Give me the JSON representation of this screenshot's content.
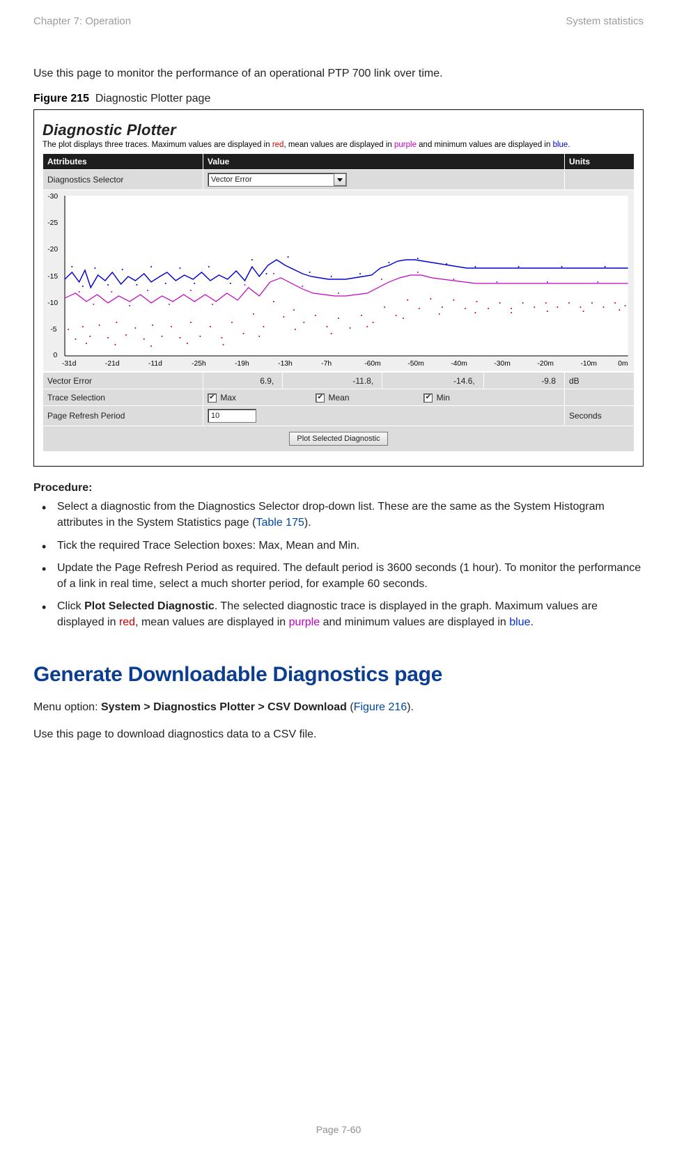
{
  "header": {
    "left": "Chapter 7:  Operation",
    "right": "System statistics"
  },
  "intro": "Use this page to monitor the performance of an operational PTP 700 link over time.",
  "figure": {
    "label": "Figure 215",
    "caption": "Diagnostic Plotter page"
  },
  "plotter": {
    "title": "Diagnostic Plotter",
    "sub_pre": "The plot displays three traces. Maximum values are displayed in ",
    "sub_red": "red",
    "sub_mid1": ", mean values are displayed in ",
    "sub_purple": "purple",
    "sub_mid2": " and minimum values are displayed in ",
    "sub_blue": "blue",
    "sub_end": ".",
    "th_attr": "Attributes",
    "th_value": "Value",
    "th_units": "Units",
    "row_selector_label": "Diagnostics Selector",
    "selector_value": "Vector Error",
    "row_vector_label": "Vector Error",
    "vector_vals": [
      "6.9,",
      "-11.8,",
      "-14.6,",
      "-9.8"
    ],
    "vector_units": "dB",
    "row_trace_label": "Trace Selection",
    "trace_opts": [
      "Max",
      "Mean",
      "Min"
    ],
    "row_refresh_label": "Page Refresh Period",
    "refresh_value": "10",
    "refresh_units": "Seconds",
    "button": "Plot Selected Diagnostic"
  },
  "chart_data": {
    "type": "line",
    "ylabel": "",
    "xlabel": "",
    "ylim": [
      0,
      -30
    ],
    "y_ticks": [
      "-30",
      "-25",
      "-20",
      "-15",
      "-10",
      "-5",
      "0"
    ],
    "x_ticks": [
      "-31d",
      "-21d",
      "-11d",
      "-25h",
      "-19h",
      "-13h",
      "-7h",
      "-60m",
      "-50m",
      "-40m",
      "-30m",
      "-20m",
      "-10m",
      "0m"
    ],
    "series": [
      {
        "name": "Max",
        "color": "#d00000"
      },
      {
        "name": "Mean",
        "color": "#c000c0"
      },
      {
        "name": "Min",
        "color": "#0000d0"
      }
    ]
  },
  "procedure": {
    "heading": "Procedure:",
    "items": [
      {
        "pre": "Select a diagnostic from the Diagnostics Selector drop-down list. These are the same as the System Histogram attributes in the System Statistics page (",
        "link": "Table 175",
        "post": ")."
      },
      {
        "text": "Tick the required Trace Selection boxes:  Max, Mean and Min."
      },
      {
        "text": "Update the Page Refresh Period as required. The default period is 3600 seconds (1 hour). To monitor the performance of a link in real time, select a much shorter period, for example 60 seconds."
      },
      {
        "pre": "Click ",
        "bold": "Plot Selected Diagnostic",
        "mid1": ". The selected diagnostic trace is displayed in the graph. Maximum values are displayed in ",
        "red": "red",
        "mid2": ", mean values are displayed in ",
        "purple": "purple",
        "mid3": " and minimum values are displayed in ",
        "blue": "blue",
        "post": "."
      }
    ]
  },
  "section2": {
    "heading": "Generate Downloadable Diagnostics page",
    "menu_pre": "Menu option: ",
    "menu_bold": "System > Diagnostics Plotter > CSV Download",
    "menu_mid": " (",
    "menu_link": "Figure 216",
    "menu_post": ").",
    "desc": "Use this page to download diagnostics data to a CSV file."
  },
  "footer": "Page 7-60"
}
